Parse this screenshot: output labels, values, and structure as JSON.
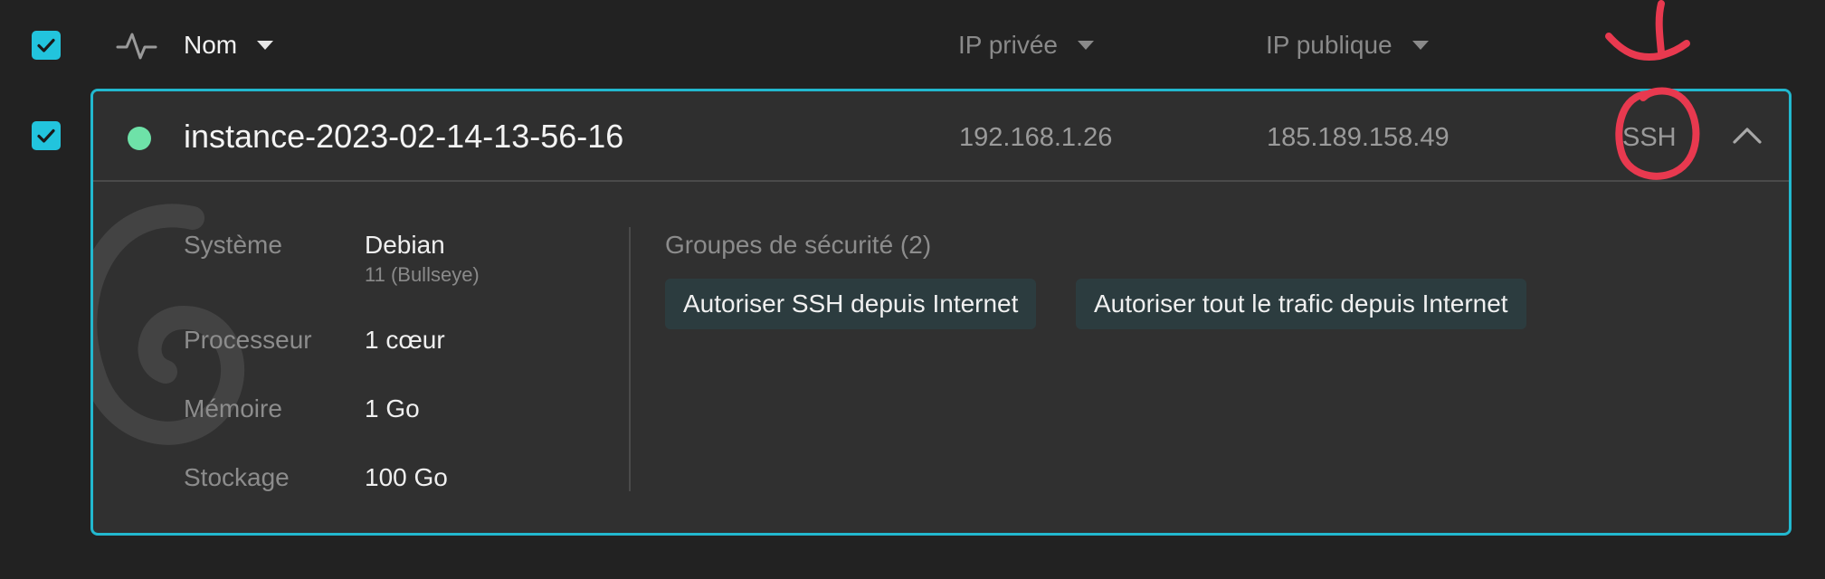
{
  "header": {
    "name_col": "Nom",
    "private_ip_col": "IP privée",
    "public_ip_col": "IP publique"
  },
  "instance": {
    "name": "instance-2023-02-14-13-56-16",
    "status_color": "#6ee2a8",
    "private_ip": "192.168.1.26",
    "public_ip": "185.189.158.49",
    "ssh_label": "SSH",
    "specs": [
      {
        "label": "Système",
        "value": "Debian",
        "sub": "11 (Bullseye)"
      },
      {
        "label": "Processeur",
        "value": "1 cœur"
      },
      {
        "label": "Mémoire",
        "value": "1 Go"
      },
      {
        "label": "Stockage",
        "value": "100 Go"
      }
    ],
    "security_groups_title": "Groupes de sécurité (2)",
    "security_groups": [
      "Autoriser SSH depuis Internet",
      "Autoriser tout le trafic depuis Internet"
    ]
  },
  "icons": {
    "select_all": "checkbox-checked-icon",
    "activity": "pulse-icon",
    "sort": "caret-down-icon",
    "collapse": "chevron-up-icon",
    "os_logo": "debian-swirl-icon"
  },
  "colors": {
    "accent": "#22c4dd",
    "annotation": "#e8394f"
  }
}
